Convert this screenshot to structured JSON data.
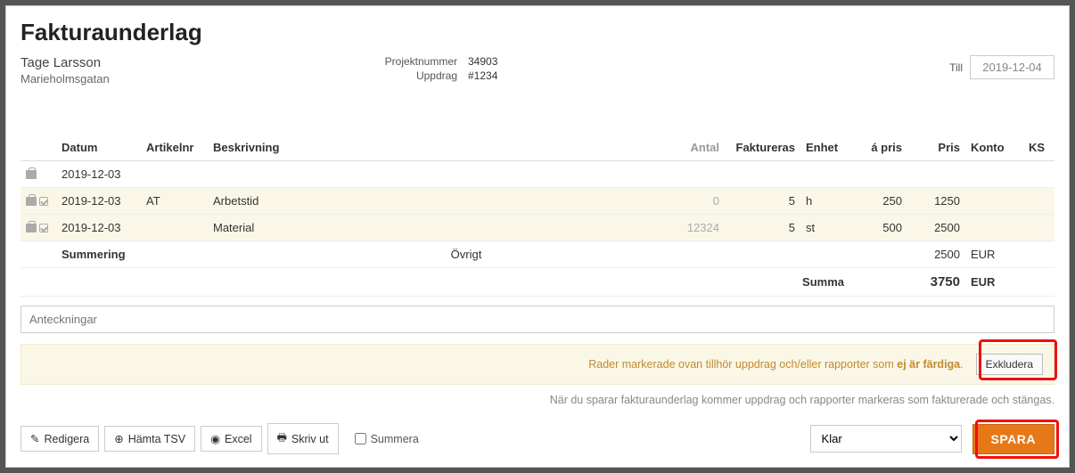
{
  "title": "Fakturaunderlag",
  "customer": {
    "name": "Tage Larsson",
    "address": "Marieholmsgatan"
  },
  "project": {
    "number_label": "Projektnummer",
    "number": "34903",
    "mission_label": "Uppdrag",
    "mission": "#1234"
  },
  "date": {
    "label": "Till",
    "value": "2019-12-04"
  },
  "columns": {
    "datum": "Datum",
    "artikelnr": "Artikelnr",
    "beskrivning": "Beskrivning",
    "antal": "Antal",
    "faktureras": "Faktureras",
    "enhet": "Enhet",
    "apris": "á pris",
    "pris": "Pris",
    "konto": "Konto",
    "ks": "KS"
  },
  "rows": [
    {
      "datum": "2019-12-03",
      "artikelnr": "",
      "beskrivning": "",
      "antal": "",
      "faktureras": "",
      "enhet": "",
      "apris": "",
      "pris": "",
      "highlight": false,
      "check": false
    },
    {
      "datum": "2019-12-03",
      "artikelnr": "AT",
      "beskrivning": "Arbetstid",
      "antal": "0",
      "faktureras": "5",
      "enhet": "h",
      "apris": "250",
      "pris": "1250",
      "highlight": true,
      "check": true
    },
    {
      "datum": "2019-12-03",
      "artikelnr": "",
      "beskrivning": "Material",
      "antal": "12324",
      "faktureras": "5",
      "enhet": "st",
      "apris": "500",
      "pris": "2500",
      "highlight": true,
      "check": true
    }
  ],
  "summary": {
    "label": "Summering",
    "ovrigt_label": "Övrigt",
    "ovrigt_value": "2500",
    "ovrigt_currency": "EUR",
    "total_label": "Summa",
    "total_value": "3750",
    "total_currency": "EUR"
  },
  "notes_placeholder": "Anteckningar",
  "warning": {
    "prefix": "Rader markerade ovan tillhör uppdrag och/eller rapporter som ",
    "strong": "ej är färdiga",
    "suffix": ".",
    "button": "Exkludera"
  },
  "info_line": "När du sparar fakturaunderlag kommer uppdrag och rapporter markeras som fakturerade och stängas.",
  "toolbar": {
    "redigera": "Redigera",
    "hamta_tsv": "Hämta TSV",
    "excel": "Excel",
    "skriv_ut": "Skriv ut",
    "summera": "Summera"
  },
  "status": {
    "selected": "Klar"
  },
  "save": "SPARA"
}
